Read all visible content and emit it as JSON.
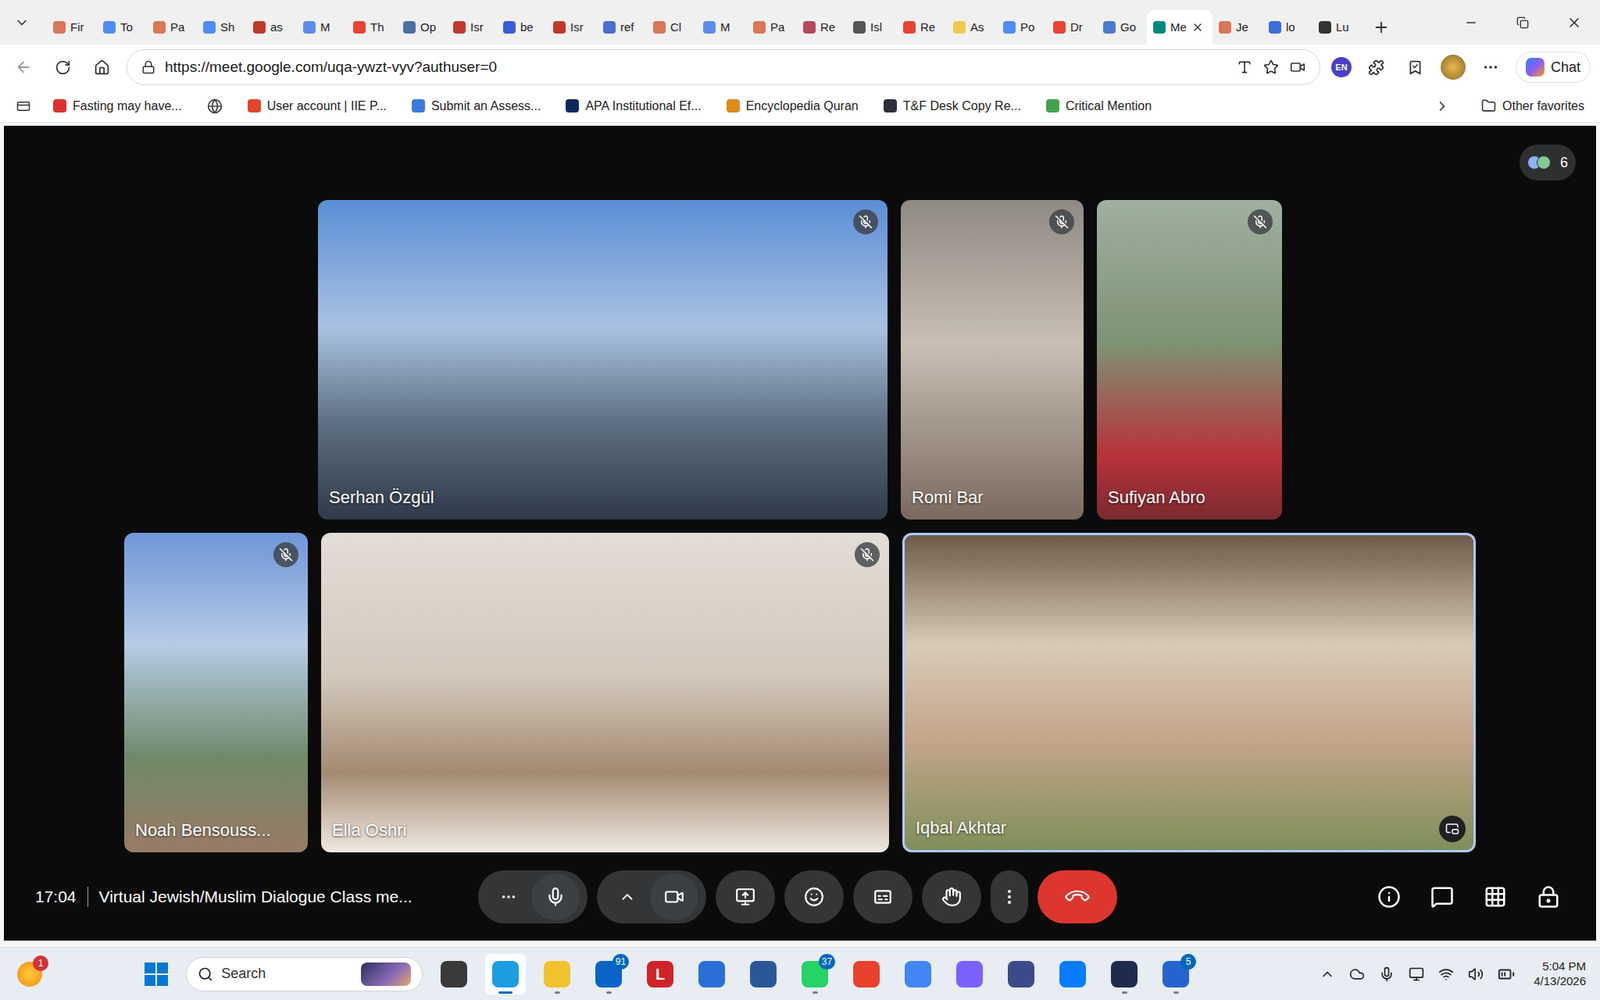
{
  "browser": {
    "tabs": [
      {
        "label": "Fir",
        "selected": false,
        "color": "#d97757"
      },
      {
        "label": "To",
        "selected": false,
        "color": "#4e8cf5"
      },
      {
        "label": "Pa",
        "selected": false,
        "color": "#d97757"
      },
      {
        "label": "Sh",
        "selected": false,
        "color": "#4e8cf5"
      },
      {
        "label": "as",
        "selected": false,
        "color": "#c0392b"
      },
      {
        "label": "M",
        "selected": false,
        "color": "#5b8def"
      },
      {
        "label": "Th",
        "selected": false,
        "color": "#ea4335"
      },
      {
        "label": "Op",
        "selected": false,
        "color": "#4a6fa5"
      },
      {
        "label": "Isr",
        "selected": false,
        "color": "#c0392b"
      },
      {
        "label": "be",
        "selected": false,
        "color": "#3b5bdb"
      },
      {
        "label": "Isr",
        "selected": false,
        "color": "#c0392b"
      },
      {
        "label": "ref",
        "selected": false,
        "color": "#4a6fd0"
      },
      {
        "label": "Cl",
        "selected": false,
        "color": "#d97757"
      },
      {
        "label": "M",
        "selected": false,
        "color": "#5b8def"
      },
      {
        "label": "Pa",
        "selected": false,
        "color": "#d97757"
      },
      {
        "label": "Re",
        "selected": false,
        "color": "#b5485a"
      },
      {
        "label": "Isl",
        "selected": false,
        "color": "#555555"
      },
      {
        "label": "Re",
        "selected": false,
        "color": "#ea4335"
      },
      {
        "label": "As",
        "selected": false,
        "color": "#f2c94c"
      },
      {
        "label": "Po",
        "selected": false,
        "color": "#4e8cf5"
      },
      {
        "label": "Dr",
        "selected": false,
        "color": "#ea4335"
      },
      {
        "label": "Go",
        "selected": false,
        "color": "#4a7bd0"
      },
      {
        "label": "Me",
        "selected": true,
        "color": "#00897b"
      },
      {
        "label": "Je",
        "selected": false,
        "color": "#d97757"
      },
      {
        "label": "lo",
        "selected": false,
        "color": "#3b6fd9"
      },
      {
        "label": "Lu",
        "selected": false,
        "color": "#333333"
      }
    ],
    "address_bar": {
      "url": "https://meet.google.com/uqa-ywzt-vyv?authuser=0"
    },
    "profile_badge": "EN",
    "chat_button": "Chat",
    "bookmarks": [
      {
        "kind": "link",
        "label": "Fasting may have...",
        "color": "#d9342b"
      },
      {
        "kind": "icon",
        "color": "#444444"
      },
      {
        "kind": "link",
        "label": "User account | IIE P...",
        "color": "#e0452b"
      },
      {
        "kind": "link",
        "label": "Submit an Assess...",
        "color": "#3d7be0"
      },
      {
        "kind": "link",
        "label": "APA Institutional Ef...",
        "color": "#0b2a5b"
      },
      {
        "kind": "link",
        "label": "Encyclopedia Quran",
        "color": "#e08a1e"
      },
      {
        "kind": "link",
        "label": "T&F Desk Copy Re...",
        "color": "#2b2f3a"
      },
      {
        "kind": "link",
        "label": "Critical Mention",
        "color": "#3fa34d"
      }
    ],
    "other_favorites": "Other favorites"
  },
  "meeting": {
    "participant_count": "6",
    "tile_rows": [
      {
        "tiles": [
          {
            "name": "Serhan Özgül",
            "muted": true,
            "active": false
          },
          {
            "name": "Romi Bar",
            "muted": true,
            "active": false
          },
          {
            "name": "Sufiyan Abro",
            "muted": true,
            "active": false
          }
        ]
      },
      {
        "tiles": [
          {
            "name": "Noah Bensouss...",
            "muted": true,
            "active": false
          },
          {
            "name": "Ella Oshri",
            "muted": true,
            "active": false
          },
          {
            "name": "Iqbal Akhtar",
            "muted": false,
            "active": true
          }
        ]
      }
    ],
    "time": "17:04",
    "title": "Virtual Jewish/Muslim Dialogue Class me...",
    "mic_on": true,
    "camera_on": true
  },
  "taskbar": {
    "notification_badge": "1",
    "search_placeholder": "Search",
    "apps": [
      {
        "color": "#3a3a3a",
        "badge": "",
        "active": false,
        "focused": false,
        "glyph": ""
      },
      {
        "color": "#1b9de2",
        "badge": "",
        "active": true,
        "focused": true,
        "glyph": ""
      },
      {
        "color": "#f2c12e",
        "badge": "",
        "active": true,
        "focused": false,
        "glyph": ""
      },
      {
        "color": "#0a64c8",
        "badge": "91",
        "active": true,
        "focused": false,
        "glyph": ""
      },
      {
        "color": "#d1232a",
        "badge": "",
        "active": false,
        "focused": false,
        "glyph": "L"
      },
      {
        "color": "#2b6fd6",
        "badge": "",
        "active": false,
        "focused": false,
        "glyph": ""
      },
      {
        "color": "#2b579a",
        "badge": "",
        "active": false,
        "focused": false,
        "glyph": ""
      },
      {
        "color": "#25d366",
        "badge": "37",
        "active": true,
        "focused": false,
        "glyph": ""
      },
      {
        "color": "#e8412c",
        "badge": "",
        "active": false,
        "focused": false,
        "glyph": ""
      },
      {
        "color": "#4285f4",
        "badge": "",
        "active": false,
        "focused": false,
        "glyph": ""
      },
      {
        "color": "#7b61ff",
        "badge": "",
        "active": false,
        "focused": false,
        "glyph": ""
      },
      {
        "color": "#3b4a8a",
        "badge": "",
        "active": false,
        "focused": false,
        "glyph": ""
      },
      {
        "color": "#0a7cff",
        "badge": "",
        "active": false,
        "focused": false,
        "glyph": ""
      },
      {
        "color": "#1f2b4d",
        "badge": "",
        "active": true,
        "focused": false,
        "glyph": ""
      },
      {
        "color": "#2564cf",
        "badge": "5",
        "active": true,
        "focused": false,
        "glyph": ""
      }
    ],
    "time": "5:04 PM",
    "date": "4/13/2026"
  }
}
